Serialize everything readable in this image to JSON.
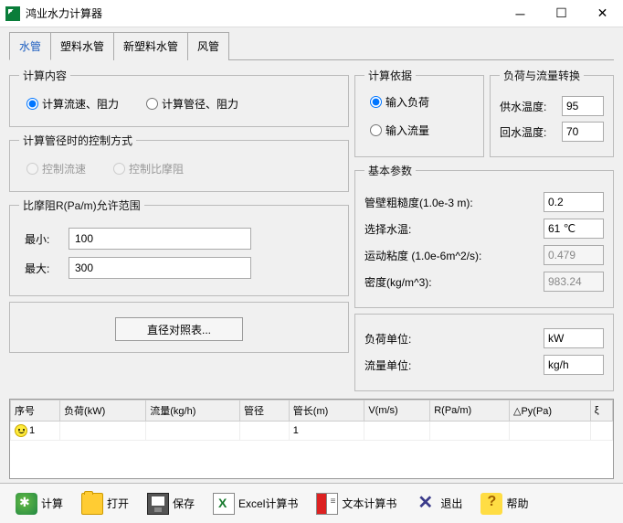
{
  "window": {
    "title": "鸿业水力计算器"
  },
  "tabs": [
    "水管",
    "塑料水管",
    "新塑料水管",
    "风管"
  ],
  "active_tab": 0,
  "calc_content": {
    "legend": "计算内容",
    "opt1": "计算流速、阻力",
    "opt2": "计算管径、阻力"
  },
  "control_mode": {
    "legend": "计算管径时的控制方式",
    "opt1": "控制流速",
    "opt2": "控制比摩阻"
  },
  "friction": {
    "legend": "比摩阻R(Pa/m)允许范围",
    "min_label": "最小:",
    "min_value": "100",
    "max_label": "最大:",
    "max_value": "300"
  },
  "diameter_btn": "直径对照表...",
  "calc_basis": {
    "legend": "计算依据",
    "opt1": "输入负荷",
    "opt2": "输入流量"
  },
  "load_conv": {
    "legend": "负荷与流量转换",
    "supply_label": "供水温度:",
    "supply_value": "95",
    "return_label": "回水温度:",
    "return_value": "70"
  },
  "basic_params": {
    "legend": "基本参数",
    "roughness_label": "管壁粗糙度(1.0e-3 m):",
    "roughness_value": "0.2",
    "temp_label": "选择水温:",
    "temp_value": "61 ℃",
    "viscosity_label": "运动粘度 (1.0e-6m^2/s):",
    "viscosity_value": "0.479",
    "density_label": "密度(kg/m^3):",
    "density_value": "983.24"
  },
  "units": {
    "load_label": "负荷单位:",
    "load_value": "kW",
    "flow_label": "流量单位:",
    "flow_value": "kg/h"
  },
  "table": {
    "headers": [
      "序号",
      "负荷(kW)",
      "流量(kg/h)",
      "管径",
      "管长(m)",
      "V(m/s)",
      "R(Pa/m)",
      "△Py(Pa)",
      "ξ"
    ],
    "rows": [
      {
        "seq": "1",
        "load": "",
        "flow": "",
        "dia": "",
        "len": "1",
        "v": "",
        "r": "",
        "dpy": "",
        "xi": ""
      }
    ]
  },
  "toolbar": {
    "calc": "计算",
    "open": "打开",
    "save": "保存",
    "excel": "Excel计算书",
    "text": "文本计算书",
    "exit": "退出",
    "help": "帮助"
  }
}
